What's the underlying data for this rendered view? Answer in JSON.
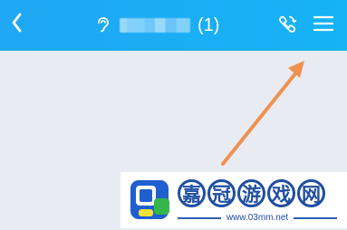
{
  "header": {
    "count": "(1)"
  },
  "icons": {
    "back": "chevron-left-icon",
    "ear": "ear-icon",
    "call": "call-refresh-icon",
    "menu": "hamburger-menu-icon",
    "annotation": "orange-arrow"
  },
  "colors": {
    "header": "#16b3f6",
    "background": "#e9ebf2",
    "arrow": "#f0914f",
    "watermark": "#1f4ea3"
  },
  "watermark": {
    "chars": [
      "嘉",
      "冠",
      "游",
      "戏",
      "网"
    ],
    "url": "www.03mm.net"
  }
}
